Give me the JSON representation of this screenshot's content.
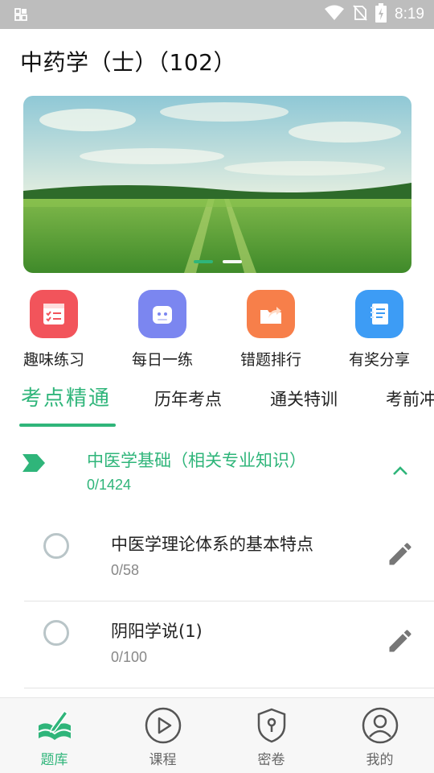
{
  "status_bar": {
    "time": "8:19",
    "icons": [
      "gallery-icon",
      "wifi-icon",
      "no-sim-icon",
      "battery-charging-icon"
    ]
  },
  "page": {
    "title": "中药学（士）（102）"
  },
  "banner": {
    "image": "green-field-landscape",
    "slide_count": 2,
    "active_slide": 1
  },
  "quick_actions": [
    {
      "label": "趣味练习",
      "icon": "checklist-icon",
      "color": "#f2545b"
    },
    {
      "label": "每日一练",
      "icon": "robot-face-icon",
      "color": "#7b86f0"
    },
    {
      "label": "错题排行",
      "icon": "folder-share-icon",
      "color": "#f77f4a"
    },
    {
      "label": "有奖分享",
      "icon": "notebook-icon",
      "color": "#3d9cf5"
    }
  ],
  "tabs": [
    {
      "label": "考点精通",
      "active": true
    },
    {
      "label": "历年考点",
      "active": false
    },
    {
      "label": "通关特训",
      "active": false
    },
    {
      "label": "考前冲",
      "active": false
    }
  ],
  "chapter": {
    "title": "中医学基础（相关专业知识）",
    "progress": "0/1424",
    "expanded": true
  },
  "sections": [
    {
      "title": "中医学理论体系的基本特点",
      "progress": "0/58"
    },
    {
      "title": "阴阳学说(1)",
      "progress": "0/100"
    }
  ],
  "bottom_nav": [
    {
      "label": "题库",
      "icon": "book-pen-icon",
      "active": true
    },
    {
      "label": "课程",
      "icon": "play-circle-icon",
      "active": false
    },
    {
      "label": "密卷",
      "icon": "shield-keyhole-icon",
      "active": false
    },
    {
      "label": "我的",
      "icon": "user-circle-icon",
      "active": false
    }
  ],
  "colors": {
    "accent": "#2fb57a",
    "status_bar": "#bdbdbd",
    "text_primary": "#222222",
    "text_secondary": "#888888"
  }
}
